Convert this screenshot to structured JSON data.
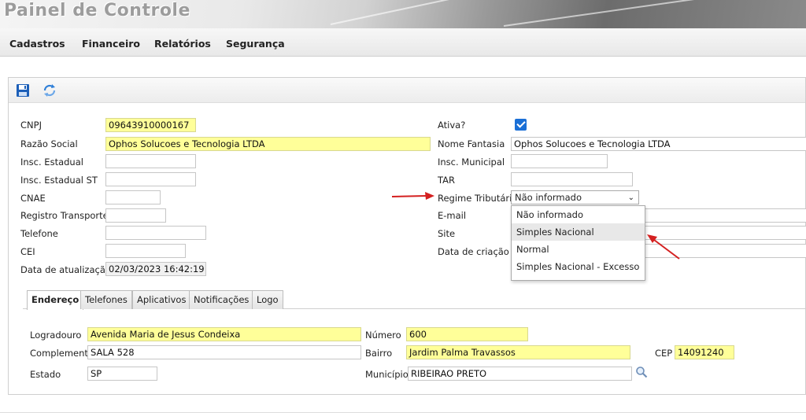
{
  "app": {
    "title": "Painel de Controle"
  },
  "menu": [
    {
      "label": "Cadastros"
    },
    {
      "label": "Financeiro"
    },
    {
      "label": "Relatórios"
    },
    {
      "label": "Segurança"
    }
  ],
  "form": {
    "cnpj": {
      "label": "CNPJ",
      "value": "09643910000167"
    },
    "razao_social": {
      "label": "Razão Social",
      "value": "Ophos Solucoes e Tecnologia LTDA"
    },
    "insc_estadual": {
      "label": "Insc. Estadual",
      "value": ""
    },
    "insc_estadual_st": {
      "label": "Insc. Estadual ST",
      "value": ""
    },
    "cnae": {
      "label": "CNAE",
      "value": ""
    },
    "registro_transporte": {
      "label": "Registro Transporte",
      "value": ""
    },
    "telefone": {
      "label": "Telefone",
      "value": ""
    },
    "cei": {
      "label": "CEI",
      "value": ""
    },
    "data_atualizacao": {
      "label": "Data de atualização",
      "value": "02/03/2023 16:42:19"
    },
    "ativa": {
      "label": "Ativa?",
      "checked": true
    },
    "nome_fantasia": {
      "label": "Nome Fantasia",
      "value": "Ophos Solucoes e Tecnologia LTDA"
    },
    "insc_municipal": {
      "label": "Insc. Municipal",
      "value": ""
    },
    "tar": {
      "label": "TAR",
      "value": ""
    },
    "regime_tributario": {
      "label": "Regime Tributário",
      "selected": "Não informado",
      "options": [
        "Não informado",
        "Simples Nacional",
        "Normal",
        "Simples Nacional - Excesso"
      ]
    },
    "email": {
      "label": "E-mail",
      "value": ""
    },
    "site": {
      "label": "Site",
      "value": ""
    },
    "data_criacao": {
      "label": "Data de criação",
      "value": ""
    }
  },
  "tabs": [
    {
      "label": "Endereço",
      "active": true
    },
    {
      "label": "Telefones"
    },
    {
      "label": "Aplicativos"
    },
    {
      "label": "Notificações"
    },
    {
      "label": "Logo"
    }
  ],
  "endereco": {
    "logradouro": {
      "label": "Logradouro",
      "value": "Avenida Maria de Jesus Condeixa"
    },
    "numero": {
      "label": "Número",
      "value": "600"
    },
    "complemento": {
      "label": "Complemento",
      "value": "SALA 528"
    },
    "bairro": {
      "label": "Bairro",
      "value": "Jardim Palma Travassos"
    },
    "cep": {
      "label": "CEP",
      "value": "14091240"
    },
    "estado": {
      "label": "Estado",
      "value": "SP"
    },
    "municipio": {
      "label": "Município",
      "value": "RIBEIRAO PRETO"
    }
  },
  "icons": {
    "save": "save-icon",
    "refresh": "refresh-icon",
    "search": "search-icon"
  },
  "colors": {
    "required_bg": "#ffff99",
    "accent": "#1a6fd6",
    "arrow": "#d42020"
  }
}
